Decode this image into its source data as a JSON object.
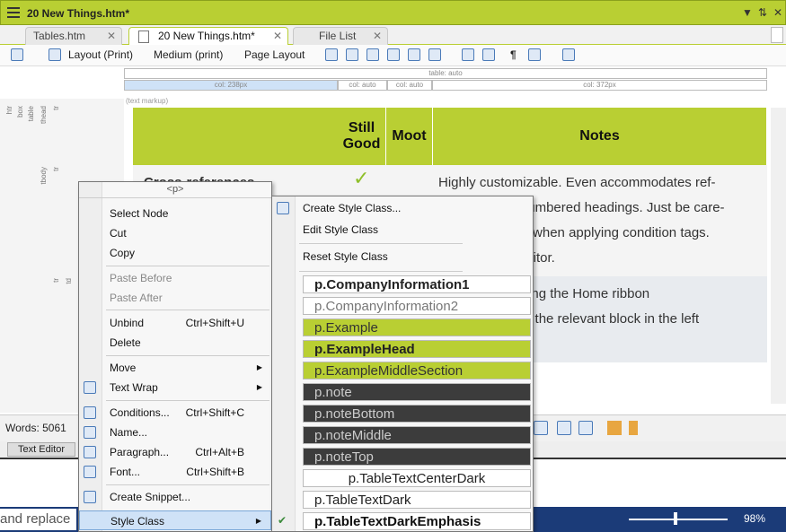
{
  "window": {
    "title": "20 New Things.htm*",
    "controls": [
      "▼",
      "⇅",
      "✕"
    ]
  },
  "tabs": [
    {
      "label": "Tables.htm",
      "close": "✕"
    },
    {
      "label": "20 New Things.htm*",
      "close": "✕"
    },
    {
      "label": "File List",
      "close": "✕"
    }
  ],
  "toolbar": {
    "layout": "Layout (Print)",
    "medium": "Medium (print)",
    "page_layout": "Page Layout"
  },
  "ruler": {
    "table": "table: auto",
    "cols": [
      "col: 238px",
      "col: auto",
      "col: auto",
      "col: 372px"
    ],
    "markup": "(text markup)"
  },
  "leftstrip": [
    "htr",
    "box",
    "table",
    "thead",
    "tr",
    "tbody",
    "tr",
    "td",
    "tr"
  ],
  "table": {
    "headers": [
      "Still Good",
      "Moot",
      "Notes"
    ],
    "row1_title": "Cross-references",
    "check": "✓",
    "notes": [
      "Highly customizable. Even accommodates ref-",
      "erences to unnumbered headings. Just be care-",
      "ful, like always, when applying condition tags.",
      "Use the Text Editor.",
      "Apply styles using the Home ribbon",
      "by right-clicking the relevant block in the left"
    ]
  },
  "context_menu": {
    "header": "<p>",
    "items": [
      {
        "label": "Select Node"
      },
      {
        "label": "Cut"
      },
      {
        "label": "Copy"
      },
      {
        "label": "Paste Before",
        "disabled": true
      },
      {
        "label": "Paste After",
        "disabled": true
      },
      {
        "label": "Unbind",
        "shortcut": "Ctrl+Shift+U"
      },
      {
        "label": "Delete"
      },
      {
        "label": "Move",
        "submenu": true
      },
      {
        "label": "Text Wrap",
        "submenu": true
      },
      {
        "label": "Conditions...",
        "shortcut": "Ctrl+Shift+C"
      },
      {
        "label": "Name..."
      },
      {
        "label": "Paragraph...",
        "shortcut": "Ctrl+Alt+B"
      },
      {
        "label": "Font...",
        "shortcut": "Ctrl+Shift+B"
      },
      {
        "label": "Create Snippet..."
      },
      {
        "label": "Style Class",
        "submenu": true
      }
    ]
  },
  "style_menu": {
    "actions": [
      "Create Style Class...",
      "Edit Style Class",
      "Reset Style Class"
    ],
    "classes": [
      {
        "label": "p.CompanyInformation1",
        "bg": "#ffffff",
        "fg": "#222222",
        "bold": true
      },
      {
        "label": "p.CompanyInformation2",
        "bg": "#ffffff",
        "fg": "#777777",
        "bold": false
      },
      {
        "label": "p.Example",
        "bg": "#b9cf33",
        "fg": "#333333",
        "bold": false
      },
      {
        "label": "p.ExampleHead",
        "bg": "#b9cf33",
        "fg": "#222222",
        "bold": true
      },
      {
        "label": "p.ExampleMiddleSection",
        "bg": "#b9cf33",
        "fg": "#333333",
        "bold": false
      },
      {
        "label": "p.note",
        "bg": "#3c3c3c",
        "fg": "#cccccc",
        "bold": false
      },
      {
        "label": "p.noteBottom",
        "bg": "#3c3c3c",
        "fg": "#cccccc",
        "bold": false
      },
      {
        "label": "p.noteMiddle",
        "bg": "#3c3c3c",
        "fg": "#cccccc",
        "bold": false
      },
      {
        "label": "p.noteTop",
        "bg": "#3c3c3c",
        "fg": "#cccccc",
        "bold": false
      },
      {
        "label": "p.TableTextCenterDark",
        "bg": "#ffffff",
        "fg": "#222222",
        "bold": false
      },
      {
        "label": "p.TableTextDark",
        "bg": "#ffffff",
        "fg": "#222222",
        "bold": false
      },
      {
        "label": "p.TableTextDarkEmphasis",
        "bg": "#ffffff",
        "fg": "#111111",
        "bold": true
      }
    ],
    "checked": "✔"
  },
  "status": {
    "words": "Words: 5061",
    "text_editor": "Text Editor"
  },
  "taskbar": {
    "find": "and replace",
    "zoom": "98%"
  },
  "colors": {
    "accent": "#b9cf33",
    "menu_bg": "#f7f7f7",
    "taskbar": "#1b3b78"
  }
}
